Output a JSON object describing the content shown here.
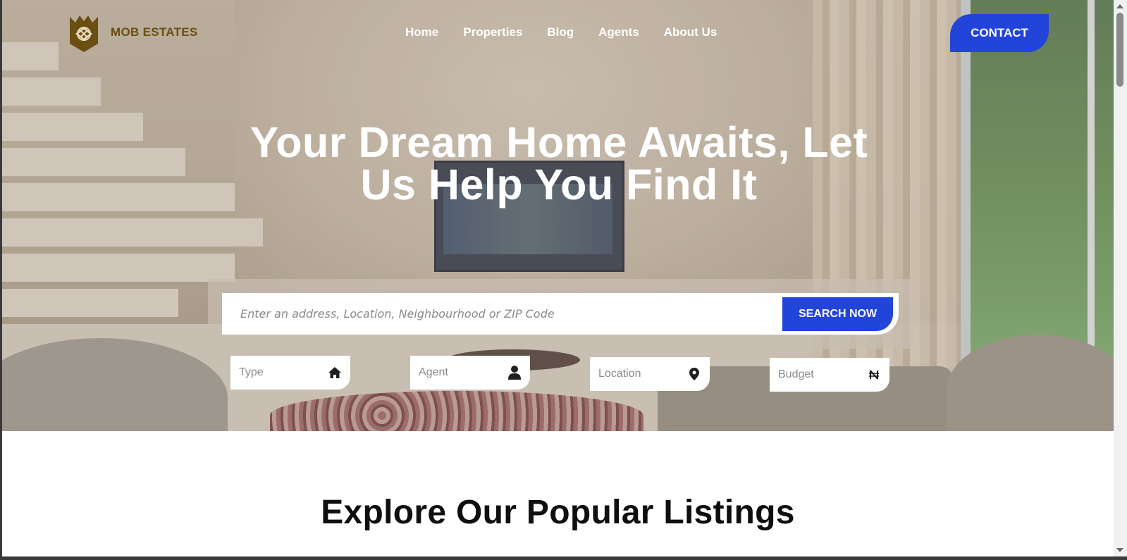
{
  "brand": {
    "name": "MOB ESTATES",
    "color": "#6b4e12"
  },
  "nav": {
    "items": [
      "Home",
      "Properties",
      "Blog",
      "Agents",
      "About Us"
    ],
    "contact_label": "CONTACT"
  },
  "hero": {
    "headline_line1": "Your Dream Home Awaits, Let",
    "headline_line2": "Us Help You Find It"
  },
  "search": {
    "placeholder": "Enter an address, Location, Neighbourhood or ZIP Code",
    "button_label": "SEARCH NOW"
  },
  "filters": {
    "type": {
      "label": "Type",
      "icon": "home-icon"
    },
    "agent": {
      "label": "Agent",
      "icon": "user-icon"
    },
    "location": {
      "label": "Location",
      "icon": "map-pin-icon"
    },
    "budget": {
      "label": "Budget",
      "icon": "naira-icon"
    }
  },
  "listings": {
    "title": "Explore Our Popular Listings"
  },
  "colors": {
    "accent": "#2344d8",
    "white": "#ffffff"
  }
}
